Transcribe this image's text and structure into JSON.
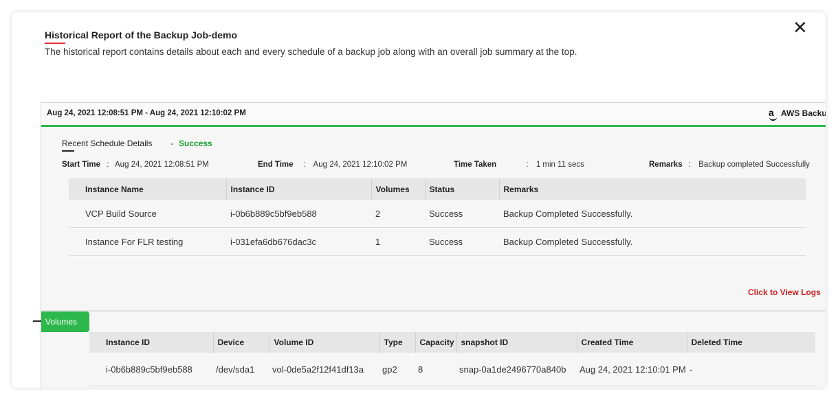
{
  "header": {
    "title": "Historical Report of the Backup Job-demo",
    "description": "The historical report contains details about each and every schedule of a backup job along with an overall job summary at the top.",
    "close_glyph": "✕"
  },
  "card": {
    "range": "Aug 24, 2021 12:08:51 PM - Aug 24, 2021 12:10:02 PM",
    "provider": "AWS Backup",
    "provider_icon": "amazon-icon",
    "recent_label": "Recent Schedule Details",
    "status_dash": "-",
    "status": "Success",
    "start_label": "Start Time",
    "start_value": "Aug 24, 2021 12:08:51 PM",
    "end_label": "End Time",
    "end_value": "Aug 24, 2021 12:10:02 PM",
    "time_label": "Time Taken",
    "time_value": "1 min 11 secs",
    "remarks_label": "Remarks",
    "remarks_value": "Backup completed Successfully",
    "colon": ":",
    "accent_color": "#2db84d"
  },
  "instances": {
    "headers": [
      "Instance Name",
      "Instance ID",
      "Volumes",
      "Status",
      "Remarks"
    ],
    "rows": [
      [
        "VCP Build Source",
        "i-0b6b889c5bf9eb588",
        "2",
        "Success",
        "Backup Completed Successfully."
      ],
      [
        "Instance For FLR testing",
        "i-031efa6db676dac3c",
        "1",
        "Success",
        "Backup Completed Successfully."
      ]
    ]
  },
  "logs_link": "Click to View Logs",
  "volumes": {
    "tab_label": "Volumes",
    "headers": [
      "Instance ID",
      "Device",
      "Volume ID",
      "Type",
      "Capacity",
      "snapshot ID",
      "Created Time",
      "Deleted Time"
    ],
    "rows": [
      [
        "i-0b6b889c5bf9eb588",
        "/dev/sda1",
        "vol-0de5a2f12f41df13a",
        "gp2",
        "8",
        "snap-0a1de2496770a840b",
        "Aug 24, 2021 12:10:01 PM",
        "-"
      ]
    ]
  }
}
